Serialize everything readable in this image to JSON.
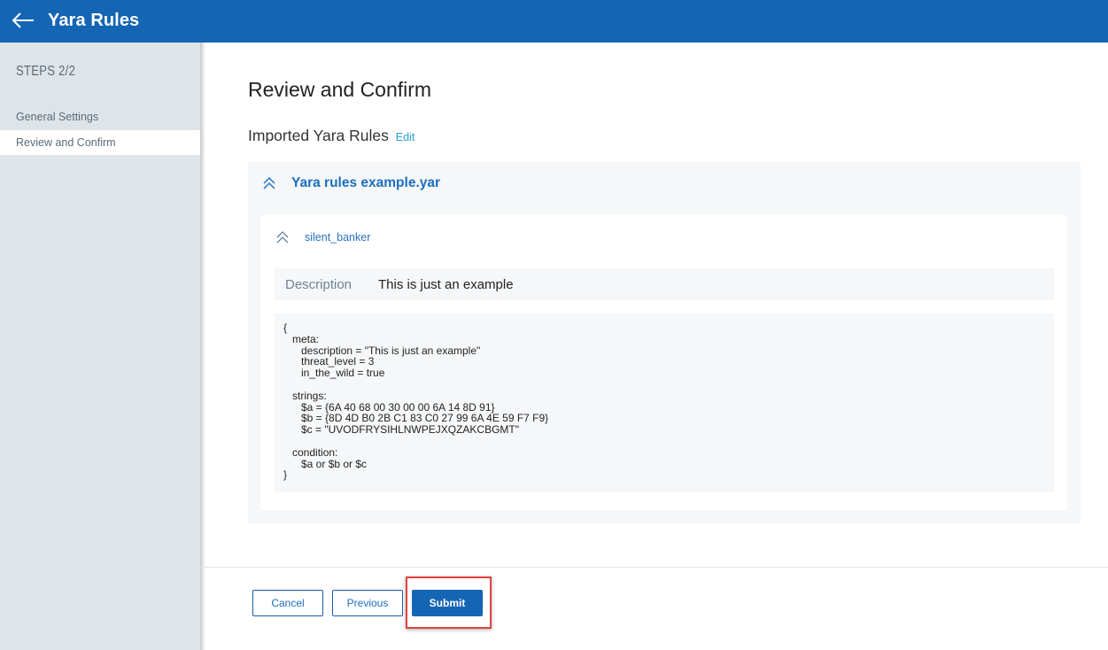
{
  "header": {
    "title": "Yara Rules",
    "back_icon": "arrow-left-icon"
  },
  "sidebar": {
    "steps_label": "STEPS 2/2",
    "items": [
      {
        "label": "General Settings",
        "active": false
      },
      {
        "label": "Review and Confirm",
        "active": true
      }
    ]
  },
  "main": {
    "page_title": "Review and Confirm",
    "section_title": "Imported Yara Rules",
    "edit_label": "Edit",
    "file": {
      "name": "Yara rules example.yar",
      "expanded": true,
      "rules": [
        {
          "name": "silent_banker",
          "expanded": true,
          "description_label": "Description",
          "description_value": "This is just an example",
          "code": "{\n   meta:\n      description = \"This is just an example\"\n      threat_level = 3\n      in_the_wild = true\n\n   strings:\n      $a = {6A 40 68 00 30 00 00 6A 14 8D 91}\n      $b = {8D 4D B0 2B C1 83 C0 27 99 6A 4E 59 F7 F9}\n      $c = \"UVODFRYSIHLNWPEJXQZAKCBGMT\"\n\n   condition:\n      $a or $b or $c\n}"
        }
      ]
    }
  },
  "footer": {
    "cancel_label": "Cancel",
    "previous_label": "Previous",
    "submit_label": "Submit"
  },
  "colors": {
    "primary": "#1565b5",
    "link": "#2a9fd8",
    "highlight": "#e0453f"
  }
}
